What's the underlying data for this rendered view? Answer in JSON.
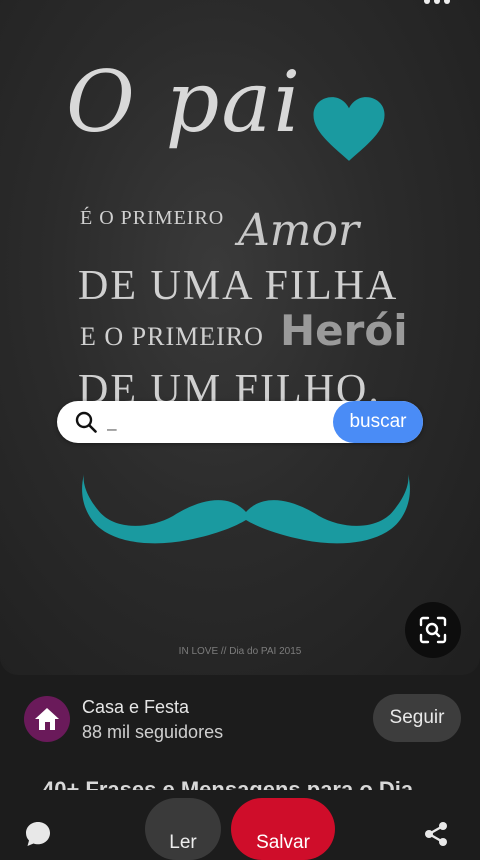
{
  "pin": {
    "quote_o_pai": "O pai",
    "quote_line1": "é o primeiro",
    "quote_amor": "Amor",
    "quote_line2": "de uma filha",
    "quote_line3": "e o primeiro",
    "quote_heroi": "Herói",
    "quote_line4": "de um filho.",
    "credit": "IN LOVE // Dia do PAI 2015",
    "accent_color": "#1a9aa0"
  },
  "search": {
    "value": "_",
    "button_label": "buscar"
  },
  "board": {
    "name": "Casa e Festa",
    "followers": "88 mil seguidores",
    "follow_label": "Seguir"
  },
  "pin_title_peek": "40+ Frases e Mensagens para o Dia",
  "bottom_bar": {
    "read_label": "Ler",
    "save_label": "Salvar"
  },
  "icons": {
    "back": "back-icon",
    "more": "more-icon",
    "lens": "visual-search-icon",
    "search": "search-icon",
    "comment": "comment-icon",
    "share": "share-icon",
    "avatar": "house-icon"
  }
}
